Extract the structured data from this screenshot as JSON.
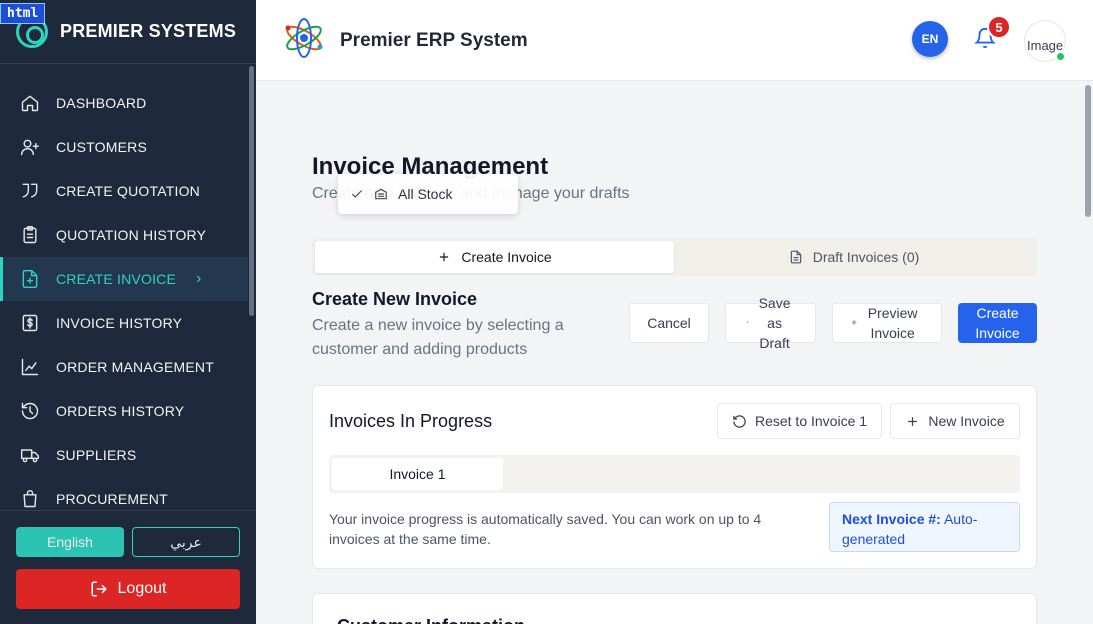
{
  "sidebar": {
    "brand": "PREMIER SYSTEMS",
    "items": [
      {
        "label": "DASHBOARD",
        "icon": "home-icon"
      },
      {
        "label": "CUSTOMERS",
        "icon": "user-plus-icon"
      },
      {
        "label": "CREATE QUOTATION",
        "icon": "quote-icon"
      },
      {
        "label": "QUOTATION HISTORY",
        "icon": "clipboard-icon"
      },
      {
        "label": "CREATE INVOICE",
        "icon": "file-plus-icon",
        "active": true
      },
      {
        "label": "INVOICE HISTORY",
        "icon": "dollar-file-icon"
      },
      {
        "label": "ORDER MANAGEMENT",
        "icon": "chart-icon"
      },
      {
        "label": "ORDERS HISTORY",
        "icon": "history-icon"
      },
      {
        "label": "SUPPLIERS",
        "icon": "truck-icon"
      },
      {
        "label": "PROCUREMENT",
        "icon": "bag-icon"
      }
    ],
    "lang_en": "English",
    "lang_ar": "عربي",
    "logout": "Logout"
  },
  "header": {
    "title": "Premier ERP System",
    "lang_code": "EN",
    "notification_count": "5",
    "avatar_alt": "Image"
  },
  "overlay_tag": "html",
  "popup": {
    "label": "All Stock"
  },
  "page": {
    "title": "Invoice Management",
    "subtitle": "Create new invoices and manage your drafts"
  },
  "tabs": {
    "create": "Create Invoice",
    "drafts": "Draft Invoices (0)"
  },
  "section": {
    "title": "Create New Invoice",
    "description": "Create a new invoice by selecting a customer and adding products",
    "cancel": "Cancel",
    "save_draft": "Save as Draft",
    "preview": "Preview Invoice",
    "create": "Create Invoice"
  },
  "progress_card": {
    "title": "Invoices In Progress",
    "reset": "Reset to Invoice 1",
    "new": "New Invoice",
    "tab": "Invoice 1",
    "note": "Your invoice progress is automatically saved. You can work on up to 4 invoices at the same time.",
    "next_label": "Next Invoice #:",
    "next_value": "Auto-generated"
  },
  "customer_card": {
    "title": "Customer Information"
  },
  "colors": {
    "sidebar_bg": "#1e293b",
    "accent": "#2dd4bf",
    "primary": "#2563eb",
    "danger": "#dc2626"
  }
}
